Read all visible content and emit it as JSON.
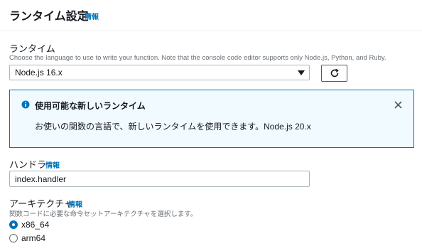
{
  "header": {
    "title": "ランタイム設定",
    "info": "情報"
  },
  "runtime": {
    "label": "ランタイム",
    "description": "Choose the language to use to write your function. Note that the console code editor supports only Node.js, Python, and Ruby.",
    "selected": "Node.js 16.x"
  },
  "alert": {
    "title": "使用可能な新しいランタイム",
    "body": "お使いの関数の言語で、新しいランタイムを使用できます。Node.js 20.x"
  },
  "handler": {
    "label": "ハンドラ",
    "info": "情報",
    "value": "index.handler"
  },
  "architecture": {
    "label": "アーキテクチャ",
    "info": "情報",
    "description": "関数コードに必要な命令セットアーキテクチャを選択します。",
    "options": [
      {
        "label": "x86_64",
        "selected": true
      },
      {
        "label": "arm64",
        "selected": false
      }
    ]
  },
  "colors": {
    "accent": "#0073bb",
    "alert_bg": "#f1faff",
    "text": "#16191f",
    "muted": "#687078"
  }
}
